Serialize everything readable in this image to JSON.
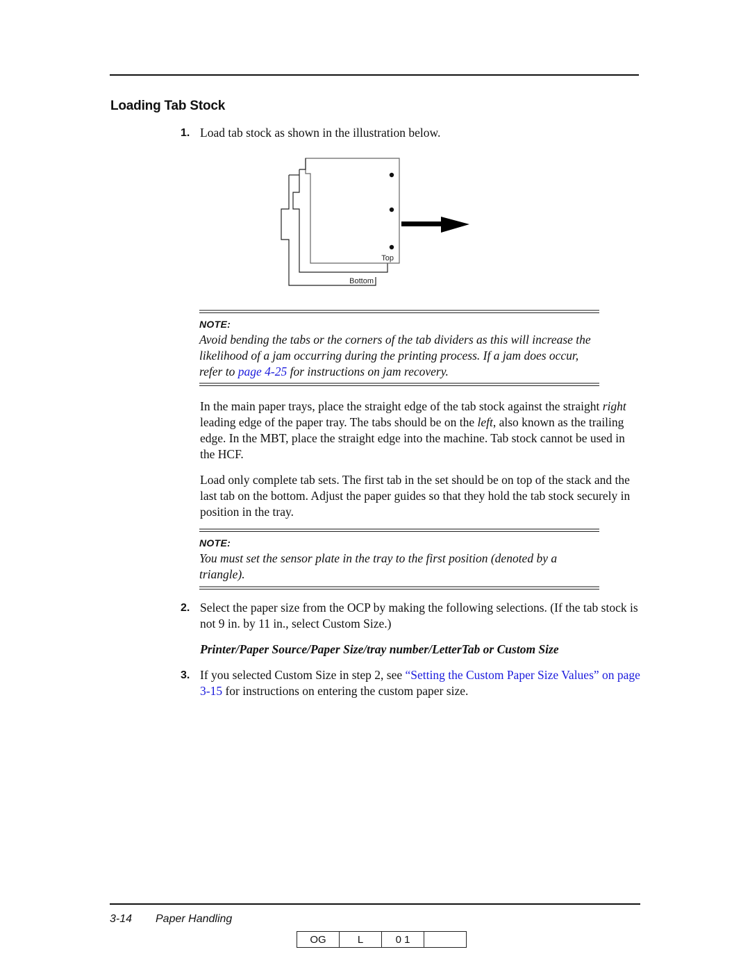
{
  "heading": "Loading Tab Stock",
  "steps": [
    {
      "num": "1.",
      "text": "Load tab stock as shown in the illustration below."
    },
    {
      "num": "2.",
      "text": "Select the paper size from the OCP by making the following selections. (If the tab stock is not 9 in. by 11 in., select Custom Size.)"
    },
    {
      "num": "3.",
      "text_before": "If you selected Custom Size in step 2, see ",
      "link": "“Setting the Custom Paper Size Values” on page 3-15",
      "text_after": " for instructions on entering the custom paper size."
    }
  ],
  "illustration": {
    "top_label": "Top",
    "bottom_label": "Bottom",
    "arrow_icon": "arrow-right-icon"
  },
  "note1": {
    "label": "NOTE:",
    "text_before": "Avoid bending the tabs or the corners of the tab dividers as this will increase the likelihood of a jam occurring during the printing process. If a jam does occur, refer to ",
    "link": "page 4-25",
    "text_after": " for instructions on jam recovery."
  },
  "para1": {
    "t1": "In the main paper trays, place the straight edge of the tab stock against the straight ",
    "em1": "right",
    "t2": " leading edge of the paper tray. The tabs should be on the ",
    "em2": "left",
    "t3": ", also known as the trailing edge. In the MBT, place the straight edge into the machine. Tab stock cannot be used in the HCF."
  },
  "para2": "Load only complete tab sets. The first tab in the set should be on top of the stack and the last tab on the bottom. Adjust the paper guides so that they hold the tab stock securely in position in the tray.",
  "note2": {
    "label": "NOTE:",
    "text": "You must set the sensor plate in the tray to the first position (denoted by a triangle)."
  },
  "command_path": "Printer/Paper Source/Paper Size/tray number/LetterTab or Custom Size",
  "footer": {
    "page_number": "3-14",
    "section": "Paper Handling",
    "codes": [
      "OG",
      "L",
      "0 1",
      ""
    ]
  },
  "colors": {
    "link": "#1a1adc",
    "note_rule": "#8a8a8a"
  }
}
